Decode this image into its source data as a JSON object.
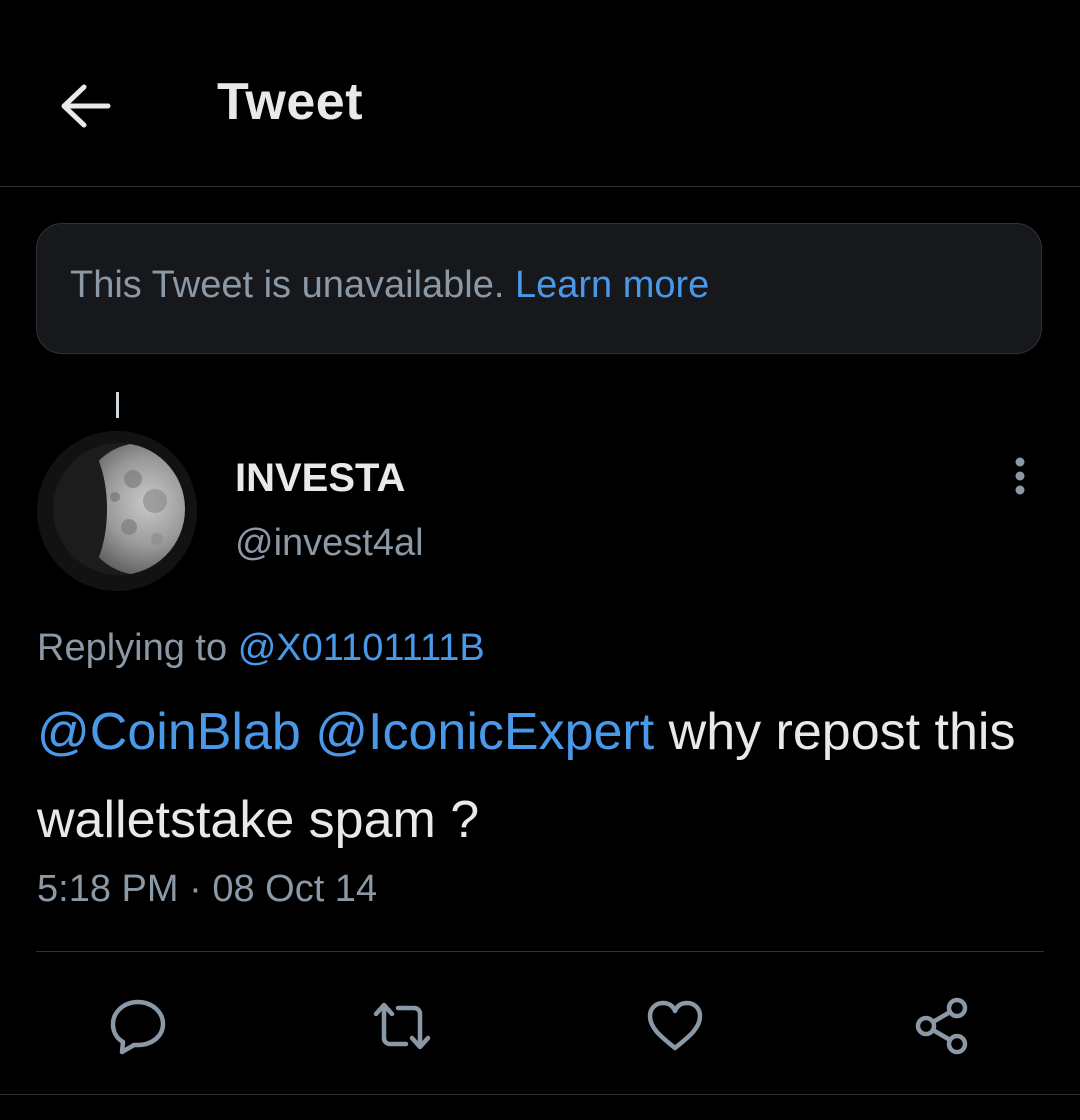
{
  "header": {
    "title": "Tweet",
    "back_icon": "arrow-left-icon"
  },
  "notice": {
    "text": "This Tweet is unavailable.",
    "link_label": "Learn more"
  },
  "tweet": {
    "author": {
      "display_name": "INVESTA",
      "handle": "@invest4al",
      "avatar": "moon-avatar"
    },
    "more_icon": "more-vertical-icon",
    "replying_prefix": "Replying to",
    "replying_to": "@X01101111B",
    "mention_1": "@CoinBlab",
    "mention_2": "@IconicExpert",
    "text_rest": "why repost this walletstake spam ?",
    "time": "5:18 PM",
    "separator": "·",
    "date": "08 Oct 14"
  },
  "actions": [
    {
      "name": "reply",
      "icon": "reply-icon"
    },
    {
      "name": "retweet",
      "icon": "retweet-icon"
    },
    {
      "name": "like",
      "icon": "heart-icon"
    },
    {
      "name": "share",
      "icon": "share-icon"
    }
  ],
  "colors": {
    "background": "#000000",
    "text_primary": "#e7e9ea",
    "text_secondary": "#8b98a5",
    "link": "#4a99e9",
    "notice_bg": "#16181c",
    "border": "#2f3336"
  }
}
